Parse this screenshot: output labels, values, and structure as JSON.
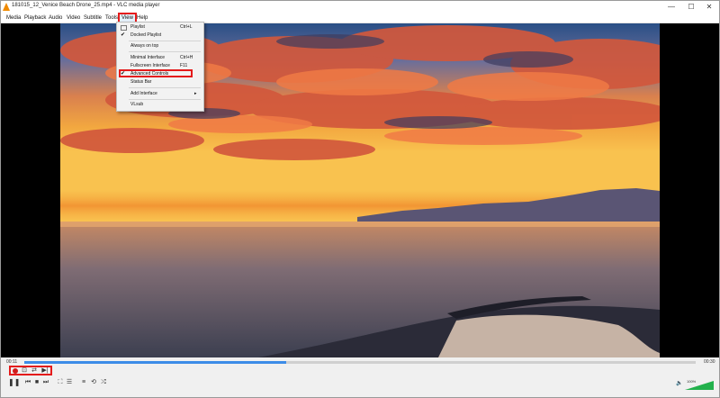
{
  "window": {
    "title": "181015_12_Venice Beach Drone_25.mp4 - VLC media player",
    "controls": {
      "minimize": "—",
      "maximize": "☐",
      "close": "✕"
    }
  },
  "menubar": {
    "items": [
      "Media",
      "Playback",
      "Audio",
      "Video",
      "Subtitle",
      "Tools",
      "View",
      "Help"
    ],
    "active": "View"
  },
  "view_menu": {
    "items": [
      {
        "label": "Playlist",
        "shortcut": "Ctrl+L",
        "checked": false,
        "icon": "playlist-icon"
      },
      {
        "label": "Docked Playlist",
        "shortcut": "",
        "checked": true
      },
      {
        "label": "Always on top",
        "shortcut": "",
        "checked": false
      },
      {
        "label": "Minimal Interface",
        "shortcut": "Ctrl+H",
        "checked": false
      },
      {
        "label": "Fullscreen Interface",
        "shortcut": "F11",
        "checked": false
      },
      {
        "label": "Advanced Controls",
        "shortcut": "",
        "checked": true
      },
      {
        "label": "Status Bar",
        "shortcut": "",
        "checked": false
      },
      {
        "label": "Add Interface",
        "shortcut": "",
        "submenu": true
      },
      {
        "label": "VLsub",
        "shortcut": ""
      }
    ],
    "check_glyph": "✔",
    "submenu_glyph": "▸"
  },
  "playback": {
    "elapsed": "00:11",
    "total": "00:30",
    "progress": 0.39
  },
  "controls": {
    "advanced": [
      "record-icon",
      "snapshot-icon",
      "loop-ab-icon",
      "frame-step-icon"
    ],
    "main": [
      "pause-icon",
      "previous-icon",
      "stop-icon",
      "next-icon",
      "fullscreen-icon",
      "extended-settings-icon",
      "playlist-icon",
      "loop-icon",
      "shuffle-icon"
    ],
    "glyphs": {
      "pause": "❚❚",
      "previous": "⏮",
      "stop": "■",
      "next": "⏭",
      "fullscreen": "⛶",
      "extended": "☰",
      "playlist": "≡",
      "loop": "⟲",
      "shuffle": "⤮",
      "snapshot": "⊡",
      "loop_ab": "⇄",
      "frame_step": "▶|",
      "volume": "🔈"
    },
    "volume_level": 1.0,
    "volume_percent": "100%"
  },
  "colors": {
    "accent": "#3c8ce7",
    "highlight": "#e41b1b",
    "record": "#d01c1c"
  }
}
